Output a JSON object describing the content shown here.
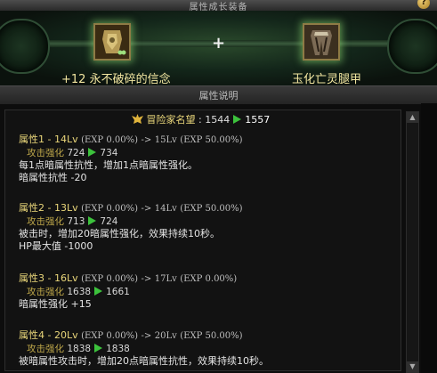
{
  "window": {
    "title": "属性成长装备",
    "help": "?"
  },
  "craft": {
    "left_item": "+12 永不破碎的信念",
    "plus": "+",
    "right_item": "玉化亡灵腿甲"
  },
  "section": {
    "title": "属性说明"
  },
  "reputation": {
    "label": "冒险家名望",
    "sep": " : ",
    "old": "1544",
    "new": "1557"
  },
  "attributes": [
    {
      "header": "属性1 - 14Lv",
      "exp_old": "(EXP 0.00%)",
      "to": "->",
      "level_new": "15Lv",
      "exp_new": "(EXP 50.00%)",
      "stat_label": "攻击强化",
      "stat_old": "724",
      "stat_new": "734",
      "desc": [
        "每1点暗属性抗性，增加1点暗属性强化。",
        "暗属性抗性 -20"
      ]
    },
    {
      "header": "属性2 - 13Lv",
      "exp_old": "(EXP 0.00%)",
      "to": "->",
      "level_new": "14Lv",
      "exp_new": "(EXP 50.00%)",
      "stat_label": "攻击强化",
      "stat_old": "713",
      "stat_new": "724",
      "desc": [
        "被击时，增加20暗属性强化，效果持续10秒。",
        "HP最大值 -1000"
      ]
    },
    {
      "header": "属性3 - 16Lv",
      "exp_old": "(EXP 0.00%)",
      "to": "->",
      "level_new": "17Lv",
      "exp_new": "(EXP 0.00%)",
      "stat_label": "攻击强化",
      "stat_old": "1638",
      "stat_new": "1661",
      "desc": [
        "暗属性强化 +15"
      ]
    },
    {
      "header": "属性4 - 20Lv",
      "exp_old": "(EXP 0.00%)",
      "to": "->",
      "level_new": "20Lv",
      "exp_new": "(EXP 50.00%)",
      "stat_label": "攻击强化",
      "stat_old": "1838",
      "stat_new": "1838",
      "desc": [
        "被暗属性攻击时，增加20点暗属性抗性，效果持续10秒。"
      ]
    }
  ],
  "colors": {
    "header": "#e9d67a",
    "arrow": "#3cc23c",
    "item_name": "#f2e6a0"
  },
  "icons": [
    "reputation-crest-icon",
    "armor-item-icon",
    "legs-item-icon",
    "help-icon",
    "scroll-up-icon",
    "scroll-down-icon"
  ]
}
